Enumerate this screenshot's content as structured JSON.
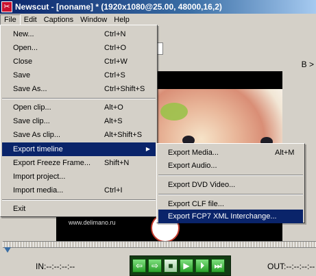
{
  "window": {
    "title": "Newscut - [noname] * (1920x1080@25.00, 48000,16,2)",
    "icon": "newscut-app-icon"
  },
  "menubar": [
    "File",
    "Edit",
    "Captions",
    "Window",
    "Help"
  ],
  "file_menu": {
    "groups": [
      [
        {
          "label": "New...",
          "shortcut": "Ctrl+N"
        },
        {
          "label": "Open...",
          "shortcut": "Ctrl+O"
        },
        {
          "label": "Close",
          "shortcut": "Ctrl+W"
        },
        {
          "label": "Save",
          "shortcut": "Ctrl+S"
        },
        {
          "label": "Save As...",
          "shortcut": "Ctrl+Shift+S"
        }
      ],
      [
        {
          "label": "Open clip...",
          "shortcut": "Alt+O"
        },
        {
          "label": "Save clip...",
          "shortcut": "Alt+S"
        },
        {
          "label": "Save As clip...",
          "shortcut": "Alt+Shift+S"
        }
      ],
      [
        {
          "label": "Export timeline",
          "shortcut": "",
          "submenu": true,
          "highlighted": true
        },
        {
          "label": "Export Freeze Frame...",
          "shortcut": "Shift+N"
        },
        {
          "label": "Import project...",
          "shortcut": ""
        },
        {
          "label": "Import media...",
          "shortcut": "Ctrl+I"
        }
      ],
      [
        {
          "label": "Exit",
          "shortcut": ""
        }
      ]
    ]
  },
  "export_submenu": {
    "groups": [
      [
        {
          "label": "Export Media...",
          "shortcut": "Alt+M"
        },
        {
          "label": "Export Audio...",
          "shortcut": ""
        }
      ],
      [
        {
          "label": "Export DVD Video...",
          "shortcut": ""
        }
      ],
      [
        {
          "label": "Export CLF file...",
          "shortcut": ""
        },
        {
          "label": "Export FCP7 XML Interchange...",
          "shortcut": "",
          "highlighted": true
        }
      ]
    ]
  },
  "viewer": {
    "b_label": "B >",
    "watermark": "www.delimano.ru"
  },
  "status": {
    "in_label": "IN:--:--:--:--",
    "out_label": "OUT:--:--:--:--"
  },
  "transport": {
    "buttons": [
      "arrow-left-icon",
      "arrow-right-icon",
      "stop-icon",
      "play-icon",
      "step-forward-icon",
      "skip-end-icon"
    ],
    "symbols": [
      "⇦",
      "⇨",
      "■",
      "▶",
      "⏵",
      "⏭"
    ]
  },
  "colors": {
    "highlight": "#0a246a",
    "title_gradient_start": "#0a246a",
    "transport_bg": "#143b14"
  }
}
